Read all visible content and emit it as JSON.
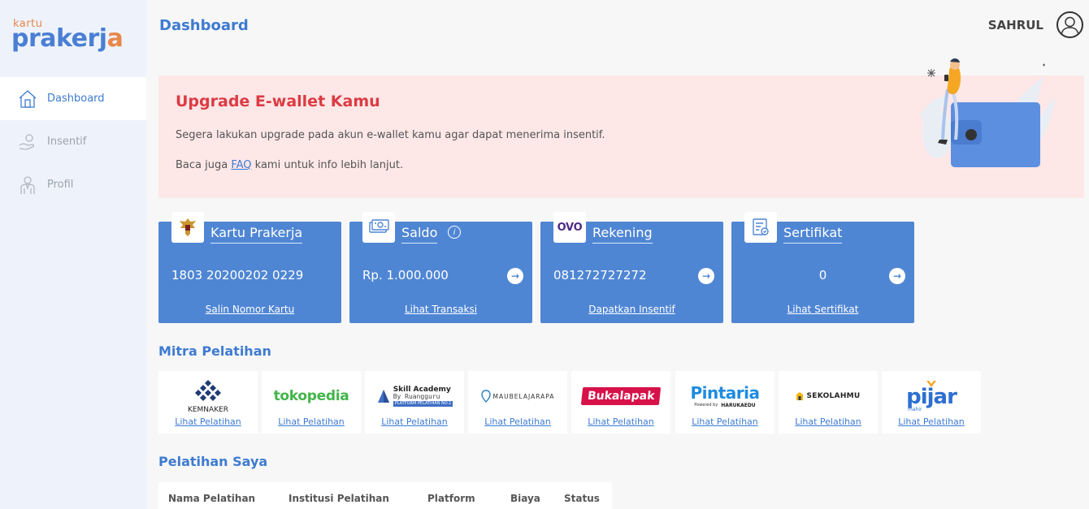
{
  "logo": {
    "small": "kartu",
    "big_a": "prakerj",
    "big_b": "a"
  },
  "sidebar": {
    "items": [
      {
        "label": "Dashboard",
        "icon": "home-icon"
      },
      {
        "label": "Insentif",
        "icon": "hand-coin-icon"
      },
      {
        "label": "Profil",
        "icon": "user-icon"
      }
    ]
  },
  "header": {
    "title": "Dashboard",
    "user": "SAHRUL"
  },
  "alert": {
    "title": "Upgrade E-wallet Kamu",
    "line1": "Segera lakukan upgrade pada akun e-wallet kamu agar dapat menerima insentif.",
    "line2_pre": "Baca juga ",
    "line2_link": "FAQ",
    "line2_post": " kami untuk info lebih lanjut."
  },
  "cards": [
    {
      "title": "Kartu Prakerja",
      "value": "1803 20200202 0229",
      "link": "Salin Nomor Kartu",
      "icon": "garuda-emblem-icon"
    },
    {
      "title": "Saldo",
      "value": "Rp. 1.000.000",
      "link": "Lihat Transaksi",
      "icon": "money-icon"
    },
    {
      "title": "Rekening",
      "value": "081272727272",
      "link": "Dapatkan Insentif",
      "icon": "ovo-logo"
    },
    {
      "title": "Sertifikat",
      "value": "0",
      "link": "Lihat Sertifikat",
      "icon": "certificate-icon"
    }
  ],
  "sections": {
    "partners": "Mitra Pelatihan",
    "my_trainings": "Pelatihan Saya"
  },
  "partners": [
    {
      "name": "KEMNAKER",
      "link": "Lihat Pelatihan"
    },
    {
      "name": "tokopedia",
      "link": "Lihat Pelatihan"
    },
    {
      "name": "Skill Academy",
      "sub": "By Ruangguru",
      "tag": "PLATFORM PELATIHAN NO.1",
      "link": "Lihat Pelatihan"
    },
    {
      "name": "MAUBELAJARAPA",
      "link": "Lihat Pelatihan"
    },
    {
      "name": "Bukalapak",
      "link": "Lihat Pelatihan"
    },
    {
      "name": "Pintaria",
      "sub": "Powered by",
      "tag": "HARUKAEDU",
      "link": "Lihat Pelatihan"
    },
    {
      "name": "SEKOLAHMU",
      "link": "Lihat Pelatihan"
    },
    {
      "name": "pijar",
      "sub": "mahir",
      "link": "Lihat Pelatihan"
    }
  ],
  "table": {
    "headers": [
      "Nama Pelatihan",
      "Institusi Pelatihan",
      "Platform",
      "Biaya",
      "Status"
    ]
  },
  "colors": {
    "primary": "#3e7bd1",
    "card": "#4f86d4",
    "alert_bg": "#fde7e7",
    "alert_title": "#dc3b43",
    "accent": "#e8874a"
  }
}
